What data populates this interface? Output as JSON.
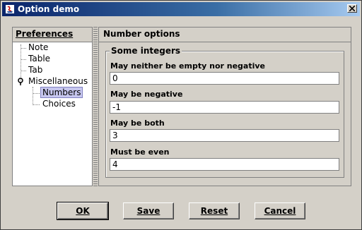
{
  "window": {
    "title": "Option demo"
  },
  "tree": {
    "header": "Preferences",
    "items": [
      {
        "label": "Note"
      },
      {
        "label": "Table"
      },
      {
        "label": "Tab"
      },
      {
        "label": "Miscellaneous"
      },
      {
        "label": "Numbers"
      },
      {
        "label": "Choices"
      }
    ]
  },
  "options": {
    "header": "Number options",
    "group_title": "Some integers",
    "fields": [
      {
        "label": "May neither be empty nor negative",
        "value": "0"
      },
      {
        "label": "May be negative",
        "value": "-1"
      },
      {
        "label": "May be both",
        "value": "3"
      },
      {
        "label": "Must be even",
        "value": "4"
      }
    ]
  },
  "buttons": {
    "ok": "OK",
    "save": "Save",
    "reset": "Reset",
    "cancel": "Cancel"
  },
  "colors": {
    "title_start": "#0a246a",
    "title_end": "#a6caf0",
    "selection": "#c7c7ef"
  }
}
